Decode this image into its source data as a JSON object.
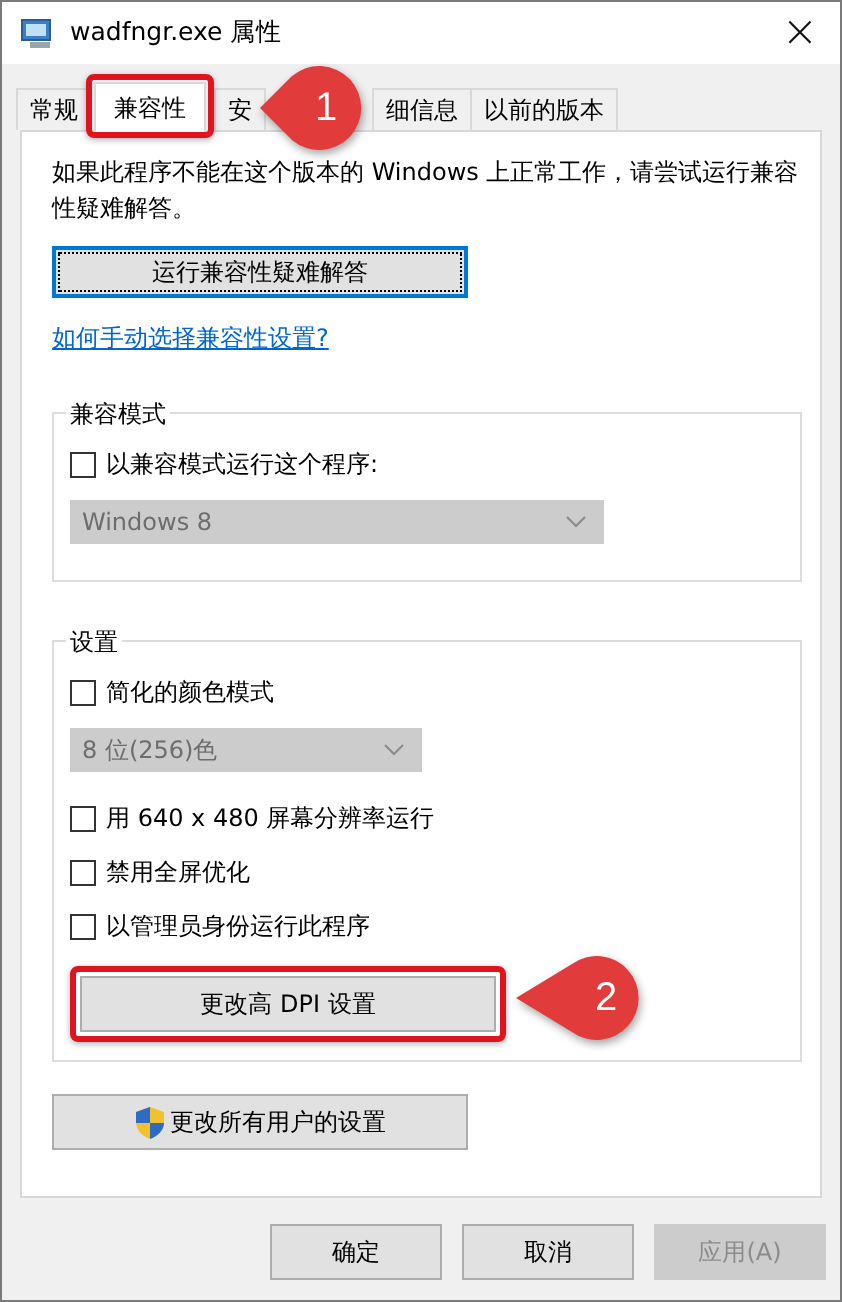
{
  "window": {
    "title": "wadfngr.exe 属性",
    "close": "×"
  },
  "tabs": [
    {
      "label": "常规",
      "selected": false,
      "highlighted": false
    },
    {
      "label": "兼容性",
      "selected": true,
      "highlighted": true,
      "callout": "1"
    },
    {
      "label": "安",
      "selected": false,
      "highlighted": false
    },
    {
      "label": "细信息",
      "selected": false,
      "highlighted": false
    },
    {
      "label": "以前的版本",
      "selected": false,
      "highlighted": false
    }
  ],
  "description": "如果此程序不能在这个版本的 Windows 上正常工作，请尝试运行兼容性疑难解答。",
  "troubleshoot_button": {
    "label": "运行兼容性疑难解答",
    "focused": true
  },
  "help_link": "如何手动选择兼容性设置?",
  "groups": [
    {
      "title": "兼容模式",
      "items": [
        {
          "kind": "checkbox",
          "label": "以兼容模式运行这个程序:",
          "checked": false
        },
        {
          "kind": "dropdown",
          "value": "Windows 8",
          "disabled": true
        }
      ]
    },
    {
      "title": "设置",
      "items": [
        {
          "kind": "checkbox",
          "label": "简化的颜色模式",
          "checked": false
        },
        {
          "kind": "dropdown",
          "value": "8 位(256)色",
          "disabled": true
        },
        {
          "kind": "checkbox",
          "label": "用 640 x 480 屏幕分辨率运行",
          "checked": false
        },
        {
          "kind": "checkbox",
          "label": "禁用全屏优化",
          "checked": false
        },
        {
          "kind": "checkbox",
          "label": "以管理员身份运行此程序",
          "checked": false
        },
        {
          "kind": "button",
          "label": "更改高 DPI 设置",
          "highlighted": true,
          "callout": "2"
        }
      ]
    }
  ],
  "all_users_button": {
    "label": "更改所有用户的设置"
  },
  "footer_buttons": [
    {
      "label": "确定",
      "disabled": false
    },
    {
      "label": "取消",
      "disabled": false
    },
    {
      "label": "应用(A)",
      "disabled": true
    }
  ]
}
